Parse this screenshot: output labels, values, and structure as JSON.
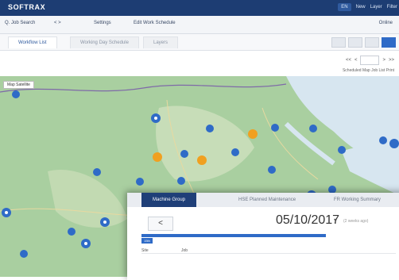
{
  "app": {
    "brand": "SOFTRAX"
  },
  "top": {
    "pill": "EN",
    "links": [
      "New",
      "Layer",
      "Filter"
    ]
  },
  "toolbar": {
    "items": [
      "Q. Job Search",
      "< >",
      "Settings",
      "Edit Work Schedule"
    ],
    "right": "Online"
  },
  "tabs": [
    "Workflow List",
    "Working Day Schedule",
    "Layers"
  ],
  "view_buttons": 4,
  "pager": {
    "prev": "<",
    "first": "<<",
    "value": "",
    "next": ">",
    "last": ">>"
  },
  "legend_text": "Scheduled Map Job List   Print",
  "map": {
    "type_control": "Map  Satellite"
  },
  "panel": {
    "tabs": [
      "Machine Group",
      "HSE Planned Maintenance",
      "FR Working Summary"
    ],
    "prev": "<",
    "date": "05/10/2017",
    "caret": "▾",
    "date_sub": "(2 weeks ago)",
    "gantt_label": "15th",
    "row_labels": [
      "Site",
      "Job"
    ]
  },
  "colors": {
    "header": "#1d3d73",
    "accent": "#2f6bc7",
    "marker_blue": "#2f6bc7",
    "marker_orange": "#f0a020",
    "land": "#a9cfa0",
    "water": "#d7e6f0"
  }
}
